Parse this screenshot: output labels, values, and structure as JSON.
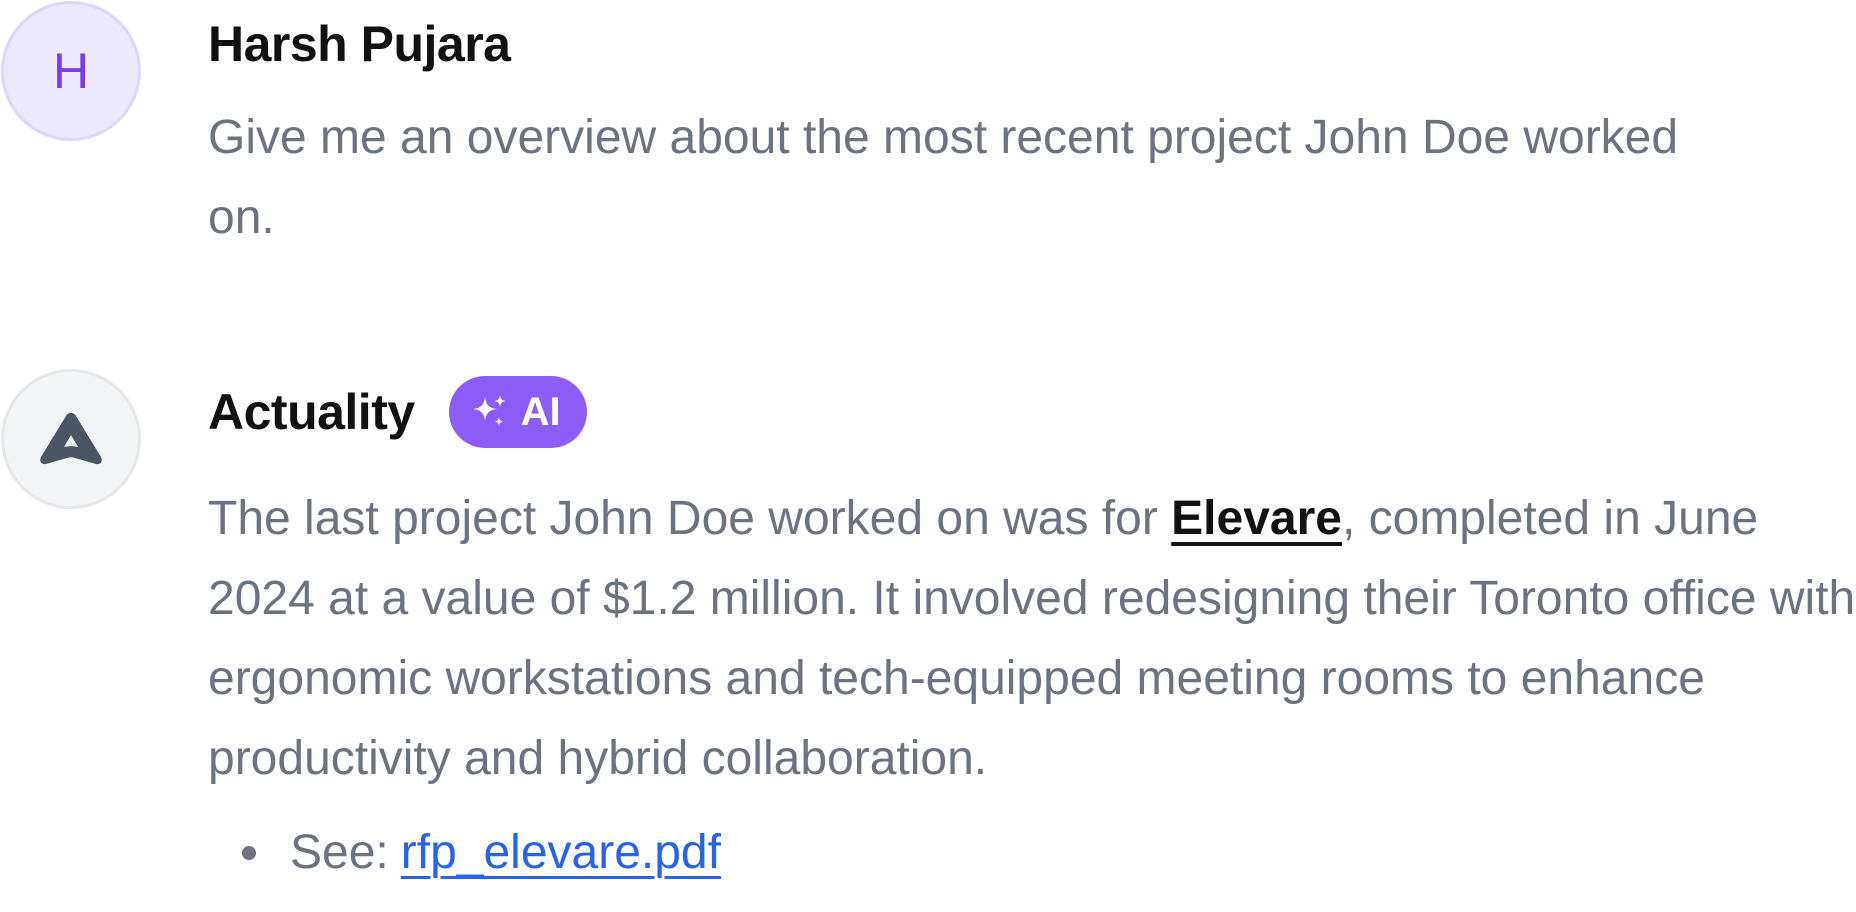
{
  "messages": {
    "user": {
      "avatar_initial": "H",
      "name": "Harsh Pujara",
      "text": "Give me an overview about the most recent project John Doe worked on."
    },
    "assistant": {
      "avatar_icon": "actuality-logo-icon",
      "name": "Actuality",
      "badge": {
        "icon": "sparkles-icon",
        "label": "AI"
      },
      "text_before_link": "The last project John Doe worked on was for ",
      "entity_link": "Elevare",
      "text_after_link": ", completed in June 2024 at a value of $1.2 million. It involved redesigning their Toronto office with ergonomic workstations and tech-equipped meeting rooms to enhance productivity and hybrid collaboration.",
      "sources": [
        {
          "prefix": "See:",
          "link_text": "rfp_elevare.pdf"
        }
      ]
    }
  },
  "colors": {
    "user_avatar_bg": "#ede9fe",
    "user_avatar_text": "#7c3aed",
    "ai_badge_bg": "#8b5cf6",
    "body_text": "#6b7280",
    "link": "#2563eb"
  }
}
